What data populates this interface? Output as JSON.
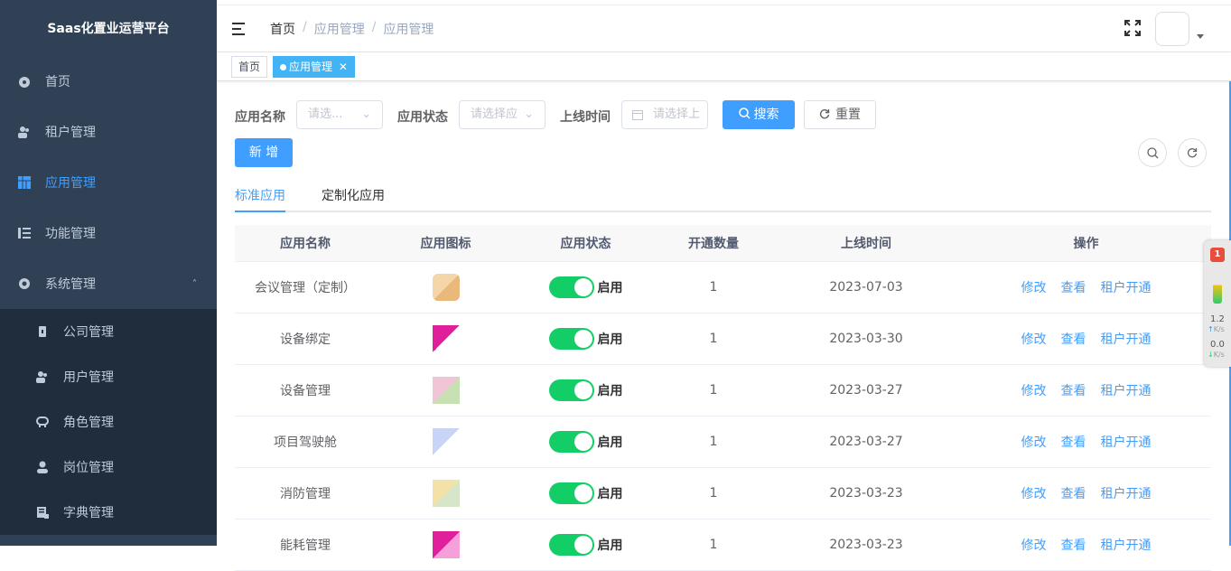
{
  "sidebar": {
    "title": "Saas化置业运营平台",
    "items": [
      {
        "label": "首页",
        "icon": "dashboard-icon"
      },
      {
        "label": "租户管理",
        "icon": "users-icon"
      },
      {
        "label": "应用管理",
        "icon": "grid-icon",
        "active": true
      },
      {
        "label": "功能管理",
        "icon": "list-icon"
      },
      {
        "label": "系统管理",
        "icon": "gear-icon",
        "expanded": true
      }
    ],
    "sub_items": [
      {
        "label": "公司管理",
        "icon": "company-icon"
      },
      {
        "label": "用户管理",
        "icon": "user-group-icon"
      },
      {
        "label": "角色管理",
        "icon": "role-icon"
      },
      {
        "label": "岗位管理",
        "icon": "person-icon"
      },
      {
        "label": "字典管理",
        "icon": "dictionary-icon"
      }
    ]
  },
  "breadcrumb": [
    "首页",
    "应用管理",
    "应用管理"
  ],
  "breadcrumb_sep": "/",
  "tags": [
    {
      "label": "首页"
    },
    {
      "label": "应用管理",
      "active": true
    }
  ],
  "filters": {
    "name_label": "应用名称",
    "name_placeholder": "请选...",
    "status_label": "应用状态",
    "status_placeholder": "请选择应",
    "time_label": "上线时间",
    "time_placeholder": "请选择上",
    "search_label": "搜索",
    "reset_label": "重置",
    "add_label": "新 增"
  },
  "tabs": [
    "标准应用",
    "定制化应用"
  ],
  "table": {
    "headers": [
      "应用名称",
      "应用图标",
      "应用状态",
      "开通数量",
      "上线时间",
      "操作"
    ],
    "rows": [
      {
        "name": "会议管理（定制）",
        "status": "启用",
        "count": "1",
        "date": "2023-07-03"
      },
      {
        "name": "设备绑定",
        "status": "启用",
        "count": "1",
        "date": "2023-03-30"
      },
      {
        "name": "设备管理",
        "status": "启用",
        "count": "1",
        "date": "2023-03-27"
      },
      {
        "name": "项目驾驶舱",
        "status": "启用",
        "count": "1",
        "date": "2023-03-27"
      },
      {
        "name": "消防管理",
        "status": "启用",
        "count": "1",
        "date": "2023-03-23"
      },
      {
        "name": "能耗管理",
        "status": "启用",
        "count": "1",
        "date": "2023-03-23"
      }
    ],
    "actions": [
      "修改",
      "查看",
      "租户开通"
    ]
  },
  "widget": {
    "badge": "1",
    "up": "1.2",
    "up_unit": "K/s",
    "down": "0.0",
    "down_unit": "K/s"
  },
  "colors": {
    "sidebar_bg": "#304156",
    "submenu_bg": "#1f2d3d",
    "accent": "#409eff",
    "switch_on": "#13ce66"
  }
}
